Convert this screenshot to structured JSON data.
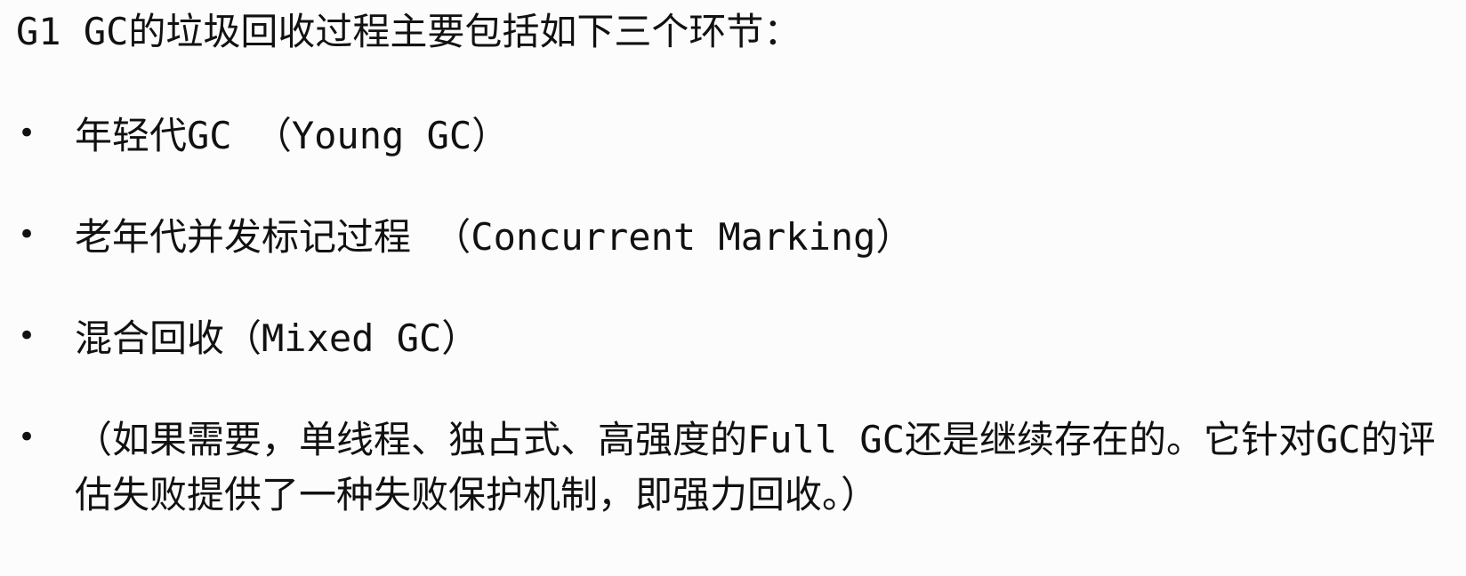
{
  "intro": "G1 GC的垃圾回收过程主要包括如下三个环节：",
  "bullet_symbol": "•",
  "items": [
    {
      "text": "年轻代GC （Young GC）"
    },
    {
      "text": "老年代并发标记过程 （Concurrent Marking）"
    },
    {
      "text": "混合回收（Mixed GC）"
    },
    {
      "text": "（如果需要，单线程、独占式、高强度的Full GC还是继续存在的。它针对GC的评估失败提供了一种失败保护机制，即强力回收。）"
    }
  ]
}
